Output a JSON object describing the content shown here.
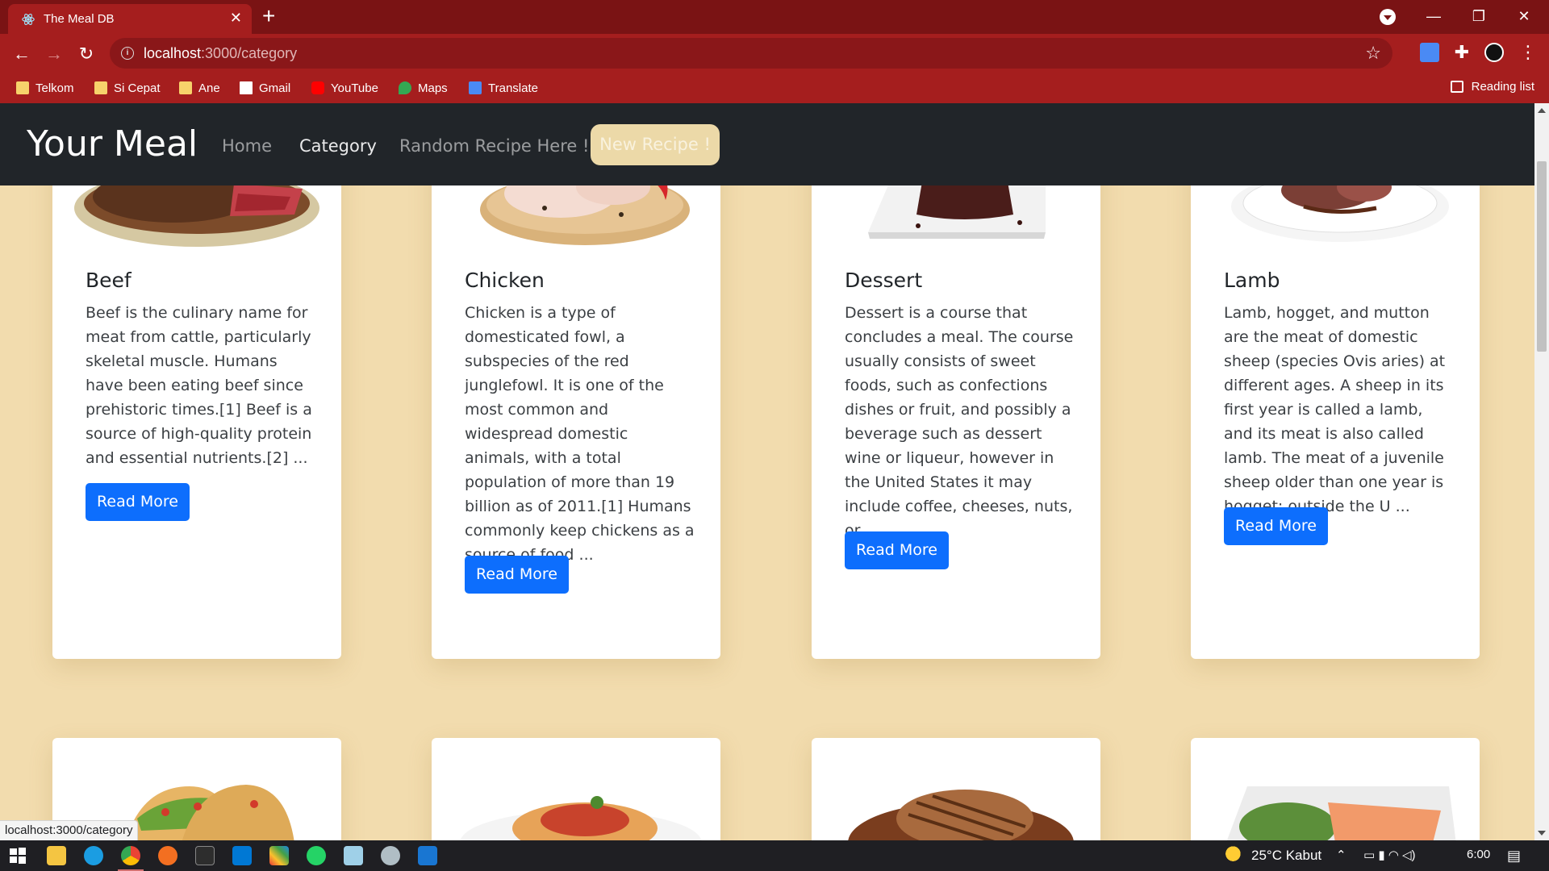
{
  "browser": {
    "tab_title": "The Meal DB",
    "url_host": "localhost",
    "url_path": ":3000/category",
    "bookmarks": [
      {
        "label": "Telkom",
        "icon": "folder-icon"
      },
      {
        "label": "Si Cepat",
        "icon": "folder-icon"
      },
      {
        "label": "Ane",
        "icon": "folder-icon"
      },
      {
        "label": "Gmail",
        "icon": "gmail-icon"
      },
      {
        "label": "YouTube",
        "icon": "youtube-icon"
      },
      {
        "label": "Maps",
        "icon": "maps-icon"
      },
      {
        "label": "Translate",
        "icon": "translate-icon"
      }
    ],
    "reading_list": "Reading list",
    "status_url": "localhost:3000/category"
  },
  "navbar": {
    "brand": "Your Meal",
    "links": [
      "Home",
      "Category",
      "Random Recipe Here !"
    ],
    "active_link": "Category",
    "cta": "New Recipe !"
  },
  "cards": [
    {
      "title": "Beef",
      "description": "Beef is the culinary name for meat from cattle, particularly skeletal muscle. Humans have been eating beef since prehistoric times.[1] Beef is a source of high-quality protein and essential nutrients.[2] ...",
      "button": "Read More"
    },
    {
      "title": "Chicken",
      "description": "Chicken is a type of domesticated fowl, a subspecies of the red junglefowl. It is one of the most common and widespread domestic animals, with a total population of more than 19 billion as of 2011.[1] Humans commonly keep chickens as a source of food ...",
      "button": "Read More"
    },
    {
      "title": "Dessert",
      "description": "Dessert is a course that concludes a meal. The course usually consists of sweet foods, such as confections dishes or fruit, and possibly a beverage such as dessert wine or liqueur, however in the United States it may include coffee, cheeses, nuts, or ...",
      "button": "Read More"
    },
    {
      "title": "Lamb",
      "description": "Lamb, hogget, and mutton are the meat of domestic sheep (species Ovis aries) at different ages. A sheep in its first year is called a lamb, and its meat is also called lamb. The meat of a juvenile sheep older than one year is hogget; outside the U ...",
      "button": "Read More"
    }
  ],
  "taskbar": {
    "weather": "25°C  Kabut",
    "time": "6:00"
  },
  "colors": {
    "page_bg": "#f2dcae",
    "navbar_bg": "#212529",
    "primary": "#0d6efd",
    "chrome": "#a51e1e"
  }
}
